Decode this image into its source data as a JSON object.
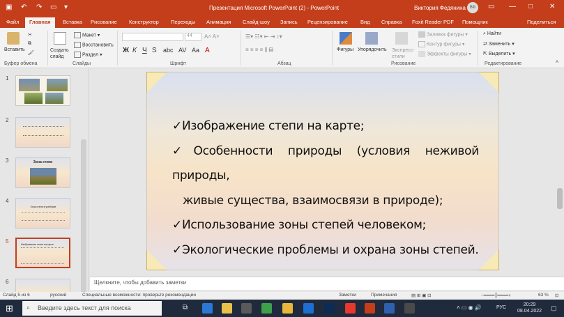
{
  "window": {
    "title": "Презентация Microsoft PowerPoint (2)  -  PowerPoint",
    "user": "Виктория Федянина",
    "avatar_initials": "ВФ"
  },
  "tabs": [
    "Файл",
    "Главная",
    "Вставка",
    "Рисование",
    "Конструктор",
    "Переходы",
    "Анимация",
    "Слайд-шоу",
    "Запись",
    "Рецензирование",
    "Вид",
    "Справка",
    "Foxit Reader PDF",
    "Помощник",
    "Поделиться"
  ],
  "ribbon": {
    "paste": "Вставить",
    "create_slide": "Создать слайд",
    "layout": "Макет",
    "reset": "Восстановить",
    "section": "Раздел",
    "font_size": "44",
    "shapes": "Фигуры",
    "arrange": "Упорядочить",
    "quick_styles": "Экспресс-стили",
    "fill": "Заливка фигуры",
    "outline": "Контур фигуры",
    "effects": "Эффекты фигуры",
    "find": "Найти",
    "replace": "Заменить",
    "select": "Выделить",
    "groups": {
      "clipboard": "Буфер обмена",
      "slides": "Слайды",
      "font": "Шрифт",
      "paragraph": "Абзац",
      "drawing": "Рисование",
      "editing": "Редактирование"
    }
  },
  "thumbnails": [
    "1",
    "2",
    "3",
    "4",
    "5",
    "6"
  ],
  "thumb_texts": {
    "t3_title": "Зона степи",
    "t4_line1": "Зона степи в учебнике",
    "t5_line1": "Изображение степи на карте"
  },
  "slide": {
    "bullet_lines": [
      "✓Изображение степи на карте;",
      "✓Особенности природы (условия неживой природы,",
      "живые существа, взаимосвязи в природе);",
      "✓Использование зоны степей человеком;",
      "✓Экологические проблемы и охрана зоны степей."
    ]
  },
  "notes_placeholder": "Щелкните, чтобы добавить заметки",
  "status": {
    "slide": "Слайд 5 из 6",
    "lang": "русский",
    "accessibility": "Специальные возможности: проверьте рекомендации",
    "notes": "Заметки",
    "comments": "Примечания",
    "zoom": "63 %"
  },
  "taskbar": {
    "search_placeholder": "Введите здесь текст для поиска",
    "time": "20:29",
    "date": "08.04.2022",
    "lang": "РУС"
  },
  "colors": {
    "accent": "#c43e1c",
    "taskbar": "#1f2a3c"
  }
}
